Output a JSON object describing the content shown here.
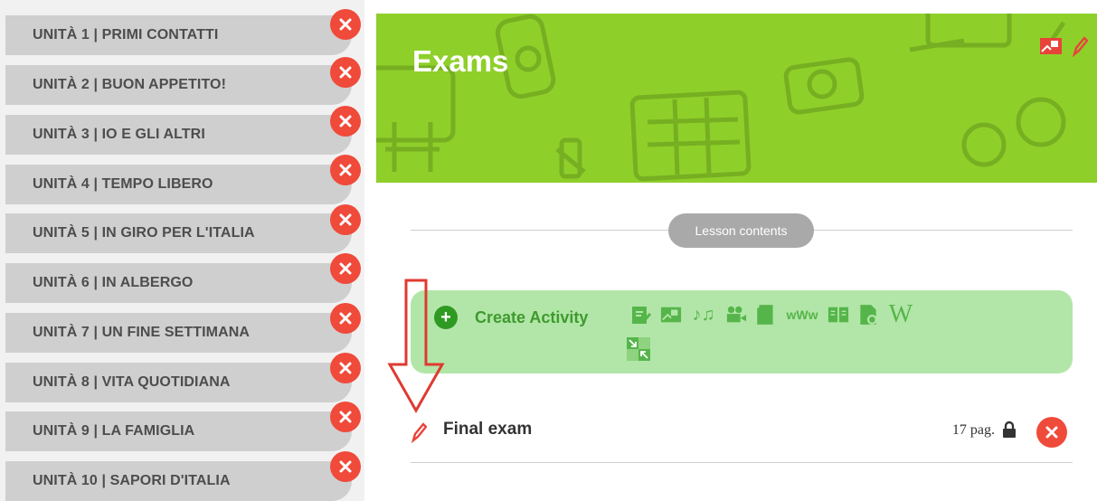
{
  "sidebar": {
    "units": [
      {
        "label": "UNITÀ 1 | PRIMI CONTATTI"
      },
      {
        "label": "UNITÀ 2 | BUON APPETITO!"
      },
      {
        "label": "UNITÀ 3 | IO E GLI ALTRI"
      },
      {
        "label": "UNITÀ 4 | TEMPO LIBERO"
      },
      {
        "label": "UNITÀ 5 | IN GIRO PER L'ITALIA"
      },
      {
        "label": "UNITÀ 6 | IN ALBERGO"
      },
      {
        "label": "UNITÀ 7 | UN FINE SETTIMANA"
      },
      {
        "label": "UNITÀ 8 | VITA QUOTIDIANA"
      },
      {
        "label": "UNITÀ 9 | LA FAMIGLIA"
      },
      {
        "label": "UNITÀ 10 | SAPORI D'ITALIA"
      }
    ]
  },
  "banner": {
    "title": "Exams",
    "color": "#8fcf2a"
  },
  "lesson": {
    "contents_label": "Lesson contents"
  },
  "create_activity": {
    "plus": "+",
    "label": "Create Activity",
    "icons": [
      "edit-note-icon",
      "image-gallery-icon",
      "music-note-icon",
      "video-camera-icon",
      "document-icon",
      "www-link-icon",
      "book-icon",
      "pdf-file-icon",
      "wikipedia-icon",
      "resize-icon"
    ],
    "wiki": "W",
    "www": "wWw"
  },
  "exam": {
    "name": "Final exam",
    "pages": "17 pag."
  },
  "colors": {
    "delete": "#f04a3a",
    "unit_bg": "#cfcfcf",
    "activity_bg": "#b2e6a8",
    "activity_accent": "#3f9a2d",
    "annotation_arrow": "#e03a30"
  }
}
